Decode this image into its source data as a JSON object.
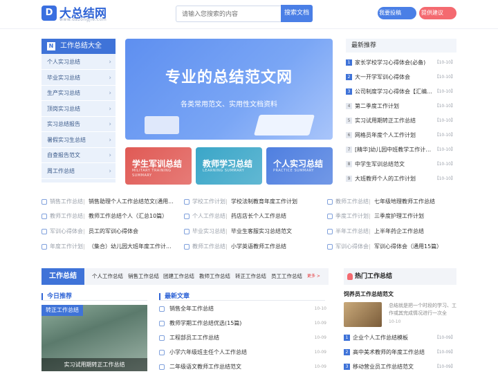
{
  "header": {
    "logo_mark": "D",
    "logo_text": "大总结网",
    "logo_sub": "www.dazongjie.com",
    "search_placeholder": "请输入您搜索的内容",
    "search_button": "搜索文档",
    "submit_button": "我要投稿",
    "suggest_button": "提供建议"
  },
  "categories": {
    "title": "工作总结大全",
    "head_icon": "N",
    "items": [
      "个人实习总结",
      "毕业实习总结",
      "生产实习总结",
      "顶岗实习总结",
      "实习总结报告",
      "暑假实习生总结",
      "自查报告范文",
      "周工作总结"
    ]
  },
  "banner": {
    "title": "专业的总结范文网",
    "subtitle": "各类常用范文、实用性文档资料"
  },
  "cards": [
    {
      "title": "学生军训总结",
      "sub": "MILITARY TRAINING SUMMARY",
      "color": "#e05a55"
    },
    {
      "title": "教师学习总结",
      "sub": "LEARNING SUMMARY",
      "color": "#3aa6c8"
    },
    {
      "title": "个人实习总结",
      "sub": "PRACTICE SUMMARY",
      "color": "#4f7fe0"
    }
  ],
  "news": {
    "title": "最新推荐",
    "items": [
      {
        "title": "家长学校学习心得体会(必备)",
        "date": "【10-10】"
      },
      {
        "title": "大一开学军训心得体会",
        "date": "【10-10】"
      },
      {
        "title": "公司制度学习心得体会【汇编15...",
        "date": "【10-10】"
      },
      {
        "title": "第二季度工作计划",
        "date": "【10-10】"
      },
      {
        "title": "实习试用期转正工作总结",
        "date": "【10-10】"
      },
      {
        "title": "网格员年度个人工作计划",
        "date": "【10-10】"
      },
      {
        "title": "[精华]幼儿园中班教学工作计划15篇",
        "date": "【10-10】"
      },
      {
        "title": "中学生军训总结范文",
        "date": "【10-10】"
      },
      {
        "title": "大班教师个人的工作计划",
        "date": "【10-10】"
      }
    ]
  },
  "links": [
    {
      "tag": "销售工作总结",
      "title": "销售助理个人工作总结范文(通用..."
    },
    {
      "tag": "学校工作计划",
      "title": "学校法制教育年度工作计划"
    },
    {
      "tag": "教师工作总结",
      "title": "七年级地理教师工作总结"
    },
    {
      "tag": "教师工作总结",
      "title": "教师工作总结个人（汇总10篇）"
    },
    {
      "tag": "个人工作总结",
      "title": "药店店长个人工作总结"
    },
    {
      "tag": "季度工作计划",
      "title": "三季度护理工作计划"
    },
    {
      "tag": "军训心得体会",
      "title": "员工的军训心得体会"
    },
    {
      "tag": "毕业实习总结",
      "title": "毕业生客服实习总结范文"
    },
    {
      "tag": "半年工作总结",
      "title": "上半年药企工作总结"
    },
    {
      "tag": "年度工作计划",
      "title": "（集合）幼儿园大班年度工作计..."
    },
    {
      "tag": "教师工作总结",
      "title": "小学英语教师工作总结"
    },
    {
      "tag": "军训心得体会",
      "title": "军训心得体会（通用15篇）"
    }
  ],
  "tabs": {
    "active": "工作总结",
    "items": [
      "个人工作总结",
      "销售工作总结",
      "团建工作总结",
      "教师工作总结",
      "转正工作总结",
      "员工工作总结"
    ],
    "more": "更多 >"
  },
  "today": {
    "title": "今日推荐",
    "badge": "转正工作总结",
    "caption": "实习试用期转正工作总结"
  },
  "latest": {
    "title": "最新文章",
    "items": [
      {
        "title": "销售全年工作总结",
        "date": "10-10"
      },
      {
        "title": "教师学期工作总结优选(15篇)",
        "date": "10-09"
      },
      {
        "title": "工程部员工工作总结",
        "date": "10-09"
      },
      {
        "title": "小学六年级班主任个人工作总结",
        "date": "10-09"
      },
      {
        "title": "二年级语文教师工作总结范文",
        "date": "10-09"
      }
    ]
  },
  "hot": {
    "title": "热门工作总结",
    "feature_title": "饲养员工作总结范文",
    "feature_desc": "总结就是把一个时段的学习、工作或其完成情况进行一次全",
    "feature_date": "10-10",
    "items": [
      {
        "title": "企业个人工作总结模板",
        "date": "【10-09】"
      },
      {
        "title": "高中美术教师的年度工作总结",
        "date": "【10-09】"
      },
      {
        "title": "移动营业员工作总结范文",
        "date": "【10-09】"
      }
    ]
  }
}
